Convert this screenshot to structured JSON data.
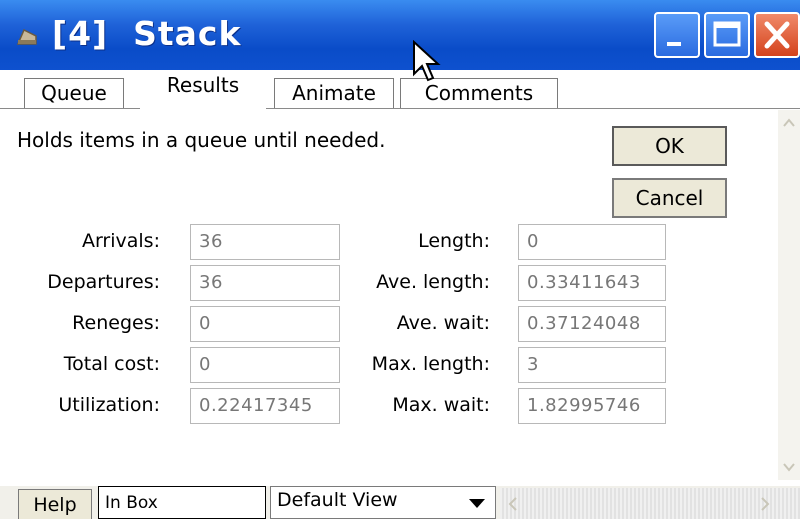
{
  "window": {
    "title": "[4]  Stack",
    "icons": {
      "app": "block-icon",
      "minimize": "minimize-icon",
      "maximize": "maximize-icon",
      "close": "close-icon"
    }
  },
  "tabs": [
    {
      "label": "Queue",
      "active": false
    },
    {
      "label": "Results",
      "active": true
    },
    {
      "label": "Animate",
      "active": false
    },
    {
      "label": "Comments",
      "active": false
    }
  ],
  "description": "Holds items in a queue until needed.",
  "buttons": {
    "ok": "OK",
    "cancel": "Cancel"
  },
  "stats_left": [
    {
      "label": "Arrivals:",
      "value": "36"
    },
    {
      "label": "Departures:",
      "value": "36"
    },
    {
      "label": "Reneges:",
      "value": "0"
    },
    {
      "label": "Total cost:",
      "value": "0"
    },
    {
      "label": "Utilization:",
      "value": "0.22417345"
    }
  ],
  "stats_right": [
    {
      "label": "Length:",
      "value": "0"
    },
    {
      "label": "Ave. length:",
      "value": "0.33411643"
    },
    {
      "label": "Ave. wait:",
      "value": "0.37124048"
    },
    {
      "label": "Max. length:",
      "value": "3"
    },
    {
      "label": "Max. wait:",
      "value": "1.82995746"
    }
  ],
  "bottom": {
    "help": "Help",
    "inbox": "In Box",
    "view": "Default View"
  }
}
